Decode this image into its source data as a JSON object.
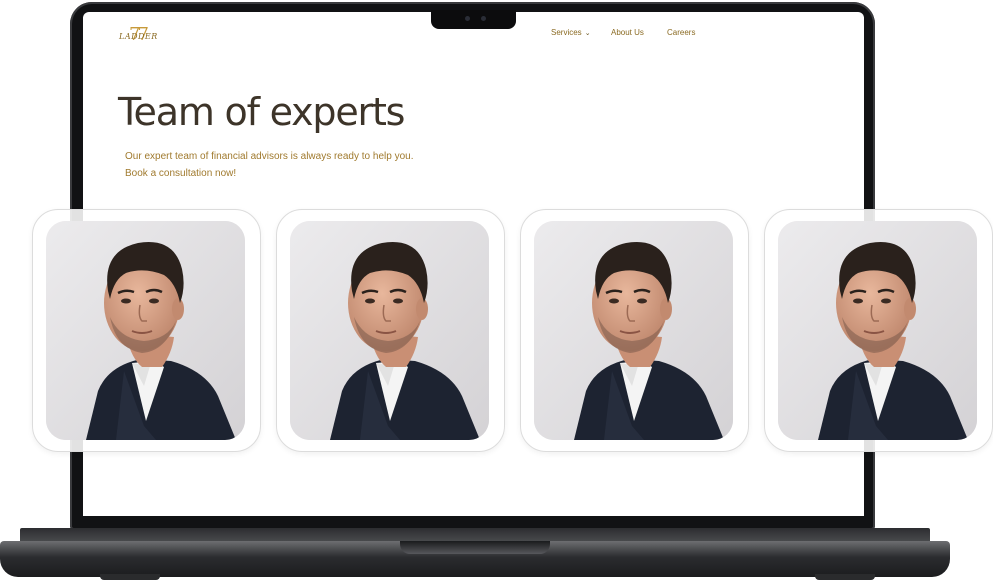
{
  "brand": {
    "logo_text": "LADDER",
    "logo_number": "77"
  },
  "nav": {
    "items": [
      {
        "label": "Services",
        "has_dropdown": true
      },
      {
        "label": "About Us",
        "has_dropdown": false
      },
      {
        "label": "Careers",
        "has_dropdown": false
      }
    ]
  },
  "hero": {
    "title": "Team of experts",
    "subtitle": "Our expert team of financial advisors is always ready to help you. Book a consultation now!"
  },
  "team": {
    "cards": [
      {
        "photo": "advisor-portrait"
      },
      {
        "photo": "advisor-portrait"
      },
      {
        "photo": "advisor-portrait"
      },
      {
        "photo": "advisor-portrait"
      }
    ]
  },
  "colors": {
    "accent": "#a07a2e",
    "heading": "#3d3429",
    "laptop_frame": "#111214"
  }
}
